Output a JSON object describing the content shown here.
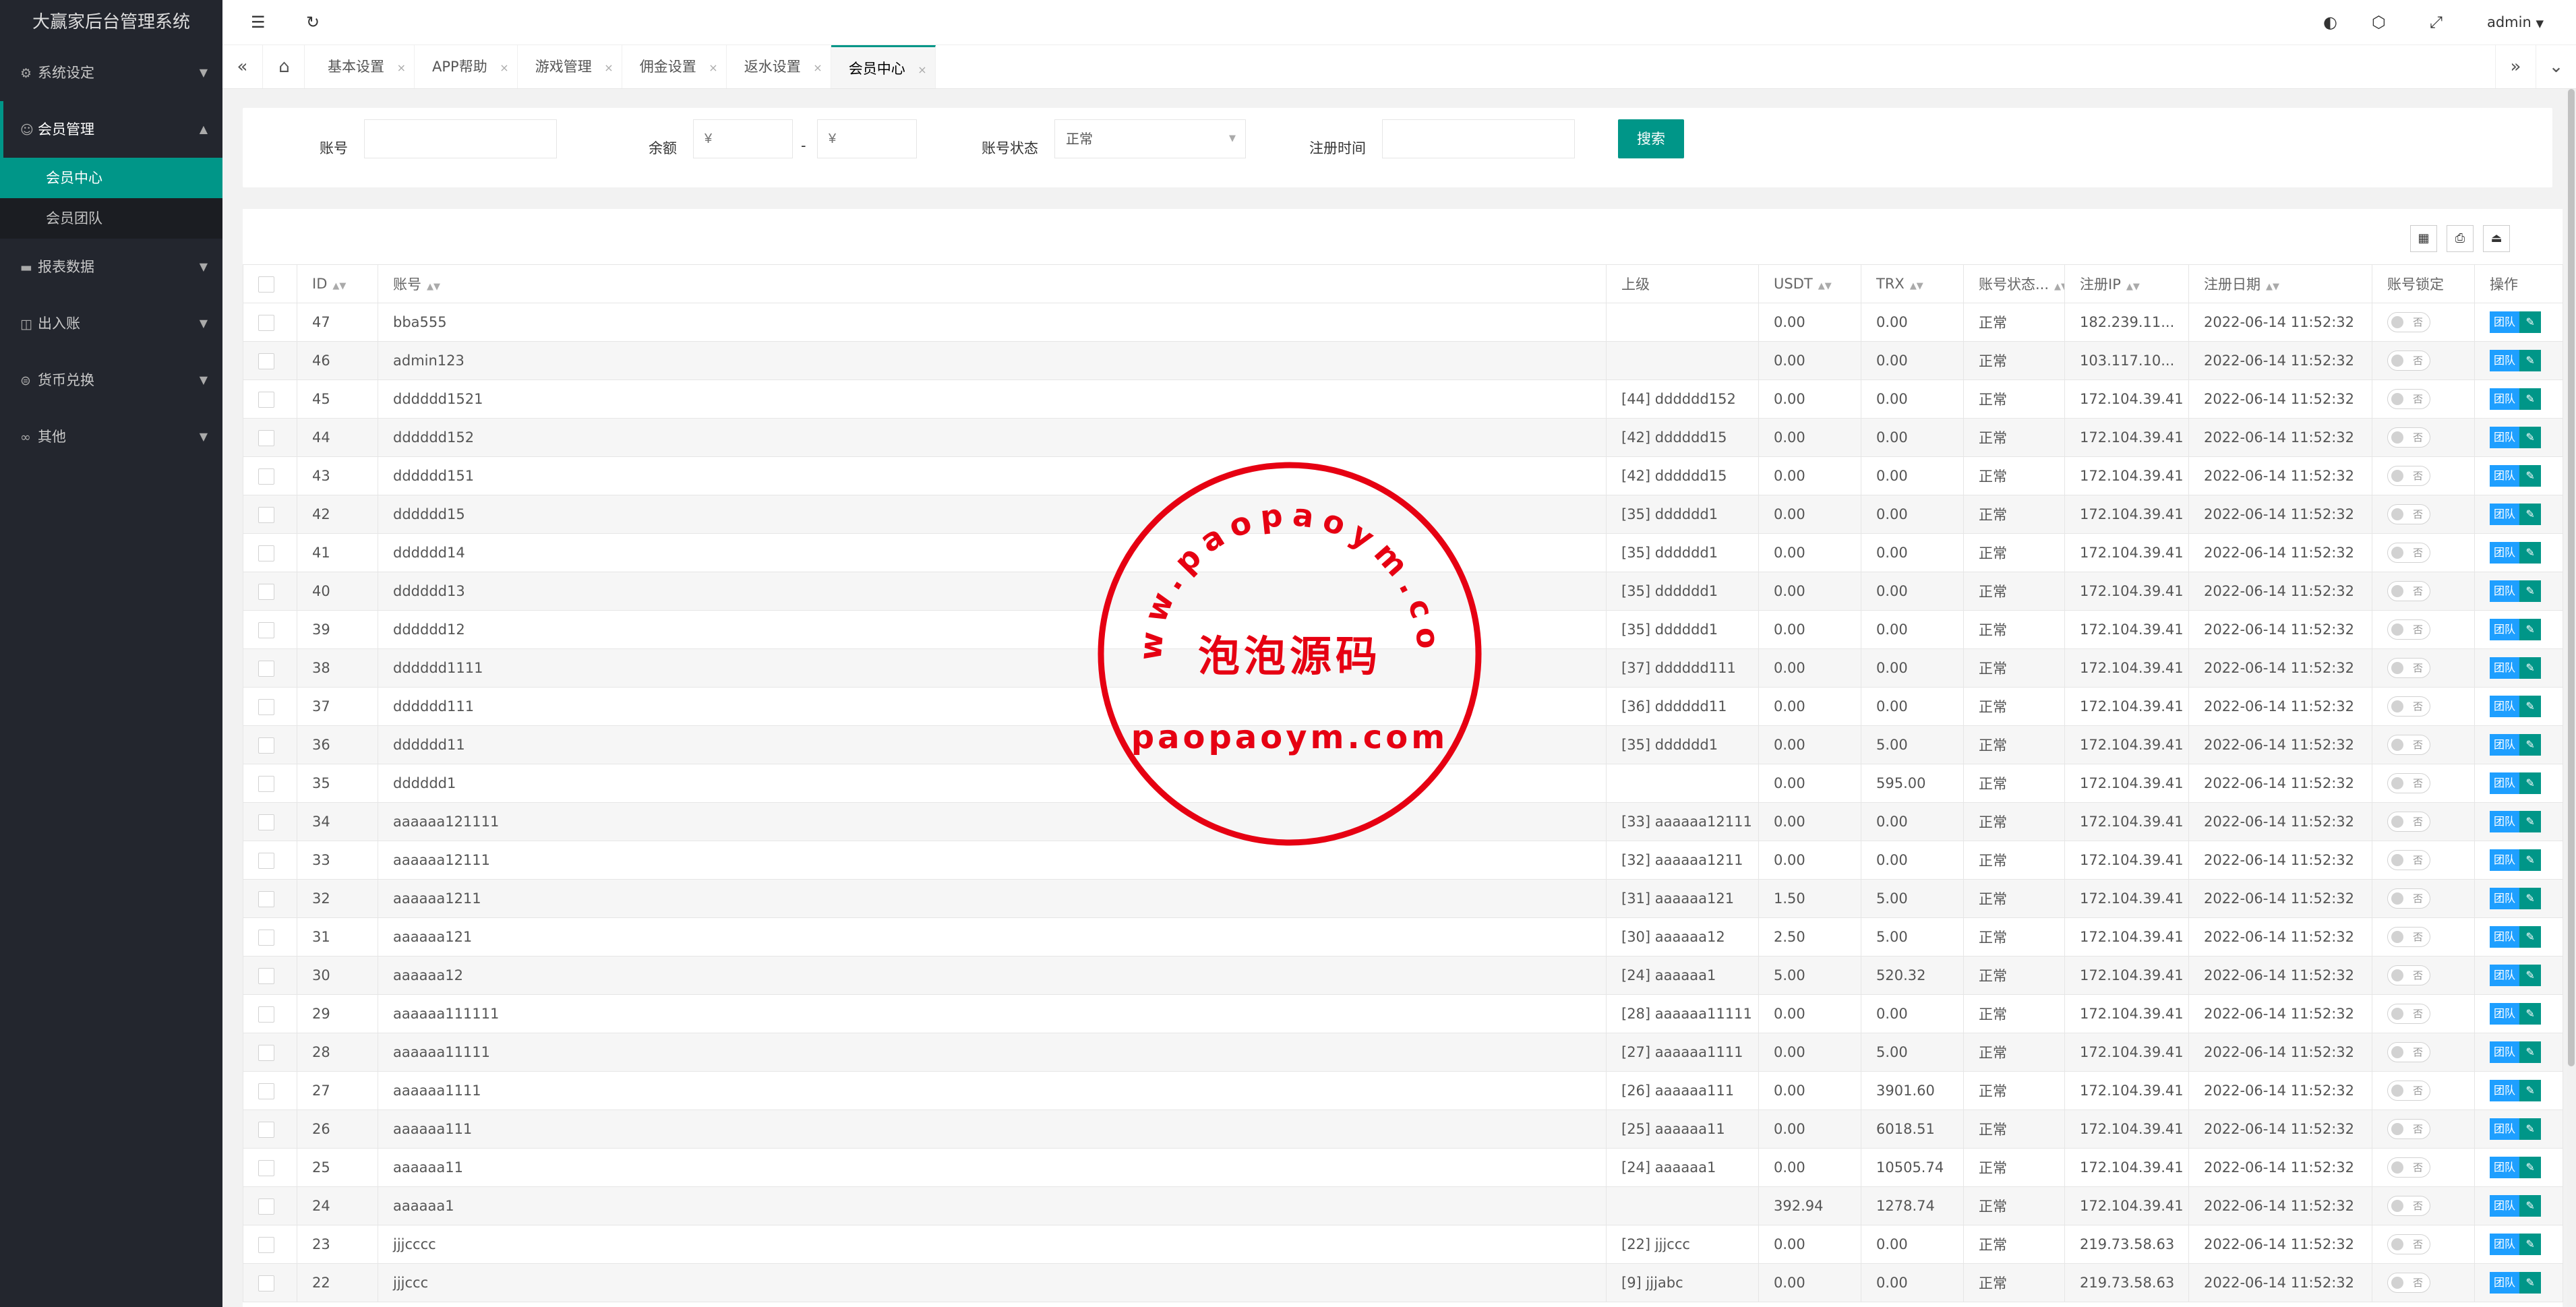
{
  "app": {
    "title": "大赢家后台管理系统"
  },
  "sidebar": {
    "items": [
      {
        "label": "系统设定",
        "icon": "gear-icon",
        "glyph": "⚙",
        "open": false
      },
      {
        "label": "会员管理",
        "icon": "user-icon",
        "glyph": "☺",
        "open": true,
        "children": [
          {
            "label": "会员中心",
            "active": true
          },
          {
            "label": "会员团队",
            "active": false
          }
        ]
      },
      {
        "label": "报表数据",
        "icon": "chat-icon",
        "glyph": "▬",
        "open": false
      },
      {
        "label": "出入账",
        "icon": "book-icon",
        "glyph": "◫",
        "open": false
      },
      {
        "label": "货币兑换",
        "icon": "currency-icon",
        "glyph": "⊜",
        "open": false
      },
      {
        "label": "其他",
        "icon": "link-icon",
        "glyph": "∞",
        "open": false
      }
    ]
  },
  "header": {
    "user": "admin"
  },
  "tabs": [
    {
      "label": "基本设置"
    },
    {
      "label": "APP帮助"
    },
    {
      "label": "游戏管理"
    },
    {
      "label": "佣金设置"
    },
    {
      "label": "返水设置"
    },
    {
      "label": "会员中心",
      "active": true
    }
  ],
  "search": {
    "account_label": "账号",
    "balance_label": "余额",
    "balance_min_placeholder": "¥",
    "balance_max_placeholder": "¥",
    "dash": "-",
    "status_label": "账号状态",
    "status_value": "正常",
    "regtime_label": "注册时间",
    "button": "搜索"
  },
  "table": {
    "columns": [
      "ID",
      "账号",
      "上级",
      "USDT",
      "TRX",
      "账号状态...",
      "注册IP",
      "注册日期",
      "账号锁定",
      "操作"
    ],
    "lock_off_text": "否",
    "team_button": "团队",
    "edit_glyph": "✎",
    "rows": [
      [
        "47",
        "bba555",
        "",
        "0.00",
        "0.00",
        "正常",
        "182.239.11...",
        "2022-06-14 11:52:32"
      ],
      [
        "46",
        "admin123",
        "",
        "0.00",
        "0.00",
        "正常",
        "103.117.10...",
        "2022-06-14 11:52:32"
      ],
      [
        "45",
        "dddddd1521",
        "[44] dddddd152",
        "0.00",
        "0.00",
        "正常",
        "172.104.39.41",
        "2022-06-14 11:52:32"
      ],
      [
        "44",
        "dddddd152",
        "[42] dddddd15",
        "0.00",
        "0.00",
        "正常",
        "172.104.39.41",
        "2022-06-14 11:52:32"
      ],
      [
        "43",
        "dddddd151",
        "[42] dddddd15",
        "0.00",
        "0.00",
        "正常",
        "172.104.39.41",
        "2022-06-14 11:52:32"
      ],
      [
        "42",
        "dddddd15",
        "[35] dddddd1",
        "0.00",
        "0.00",
        "正常",
        "172.104.39.41",
        "2022-06-14 11:52:32"
      ],
      [
        "41",
        "dddddd14",
        "[35] dddddd1",
        "0.00",
        "0.00",
        "正常",
        "172.104.39.41",
        "2022-06-14 11:52:32"
      ],
      [
        "40",
        "dddddd13",
        "[35] dddddd1",
        "0.00",
        "0.00",
        "正常",
        "172.104.39.41",
        "2022-06-14 11:52:32"
      ],
      [
        "39",
        "dddddd12",
        "[35] dddddd1",
        "0.00",
        "0.00",
        "正常",
        "172.104.39.41",
        "2022-06-14 11:52:32"
      ],
      [
        "38",
        "dddddd1111",
        "[37] dddddd111",
        "0.00",
        "0.00",
        "正常",
        "172.104.39.41",
        "2022-06-14 11:52:32"
      ],
      [
        "37",
        "dddddd111",
        "[36] dddddd11",
        "0.00",
        "0.00",
        "正常",
        "172.104.39.41",
        "2022-06-14 11:52:32"
      ],
      [
        "36",
        "dddddd11",
        "[35] dddddd1",
        "0.00",
        "5.00",
        "正常",
        "172.104.39.41",
        "2022-06-14 11:52:32"
      ],
      [
        "35",
        "dddddd1",
        "",
        "0.00",
        "595.00",
        "正常",
        "172.104.39.41",
        "2022-06-14 11:52:32"
      ],
      [
        "34",
        "aaaaaa121111",
        "[33] aaaaaa12111",
        "0.00",
        "0.00",
        "正常",
        "172.104.39.41",
        "2022-06-14 11:52:32"
      ],
      [
        "33",
        "aaaaaa12111",
        "[32] aaaaaa1211",
        "0.00",
        "0.00",
        "正常",
        "172.104.39.41",
        "2022-06-14 11:52:32"
      ],
      [
        "32",
        "aaaaaa1211",
        "[31] aaaaaa121",
        "1.50",
        "5.00",
        "正常",
        "172.104.39.41",
        "2022-06-14 11:52:32"
      ],
      [
        "31",
        "aaaaaa121",
        "[30] aaaaaa12",
        "2.50",
        "5.00",
        "正常",
        "172.104.39.41",
        "2022-06-14 11:52:32"
      ],
      [
        "30",
        "aaaaaa12",
        "[24] aaaaaa1",
        "5.00",
        "520.32",
        "正常",
        "172.104.39.41",
        "2022-06-14 11:52:32"
      ],
      [
        "29",
        "aaaaaa111111",
        "[28] aaaaaa11111",
        "0.00",
        "0.00",
        "正常",
        "172.104.39.41",
        "2022-06-14 11:52:32"
      ],
      [
        "28",
        "aaaaaa11111",
        "[27] aaaaaa1111",
        "0.00",
        "5.00",
        "正常",
        "172.104.39.41",
        "2022-06-14 11:52:32"
      ],
      [
        "27",
        "aaaaaa1111",
        "[26] aaaaaa111",
        "0.00",
        "3901.60",
        "正常",
        "172.104.39.41",
        "2022-06-14 11:52:32"
      ],
      [
        "26",
        "aaaaaa111",
        "[25] aaaaaa11",
        "0.00",
        "6018.51",
        "正常",
        "172.104.39.41",
        "2022-06-14 11:52:32"
      ],
      [
        "25",
        "aaaaaa11",
        "[24] aaaaaa1",
        "0.00",
        "10505.74",
        "正常",
        "172.104.39.41",
        "2022-06-14 11:52:32"
      ],
      [
        "24",
        "aaaaaa1",
        "",
        "392.94",
        "1278.74",
        "正常",
        "172.104.39.41",
        "2022-06-14 11:52:32"
      ],
      [
        "23",
        "jjjcccc",
        "[22] jjjccc",
        "0.00",
        "0.00",
        "正常",
        "219.73.58.63",
        "2022-06-14 11:52:32"
      ],
      [
        "22",
        "jjjccc",
        "[9] jjjabc",
        "0.00",
        "0.00",
        "正常",
        "219.73.58.63",
        "2022-06-14 11:52:32"
      ]
    ]
  },
  "watermark": {
    "arc_text": "www.paopaoym.com",
    "cn_text": "泡泡源码",
    "domain_text": "paopaoym.com",
    "color": "#e60012"
  }
}
